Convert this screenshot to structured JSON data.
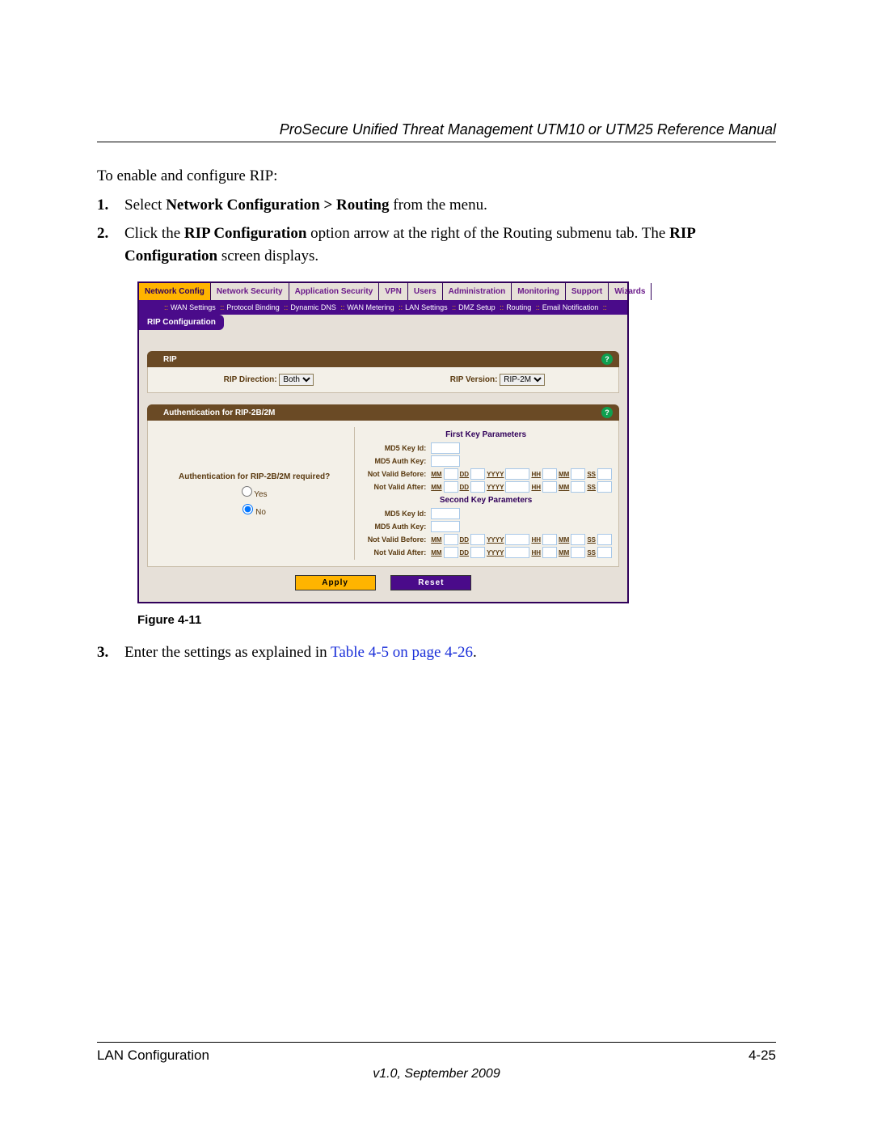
{
  "header": {
    "title": "ProSecure Unified Threat Management UTM10 or UTM25 Reference Manual"
  },
  "intro": "To enable and configure RIP:",
  "steps": {
    "s1": {
      "num": "1.",
      "prefix": "Select ",
      "bold": "Network Configuration > Routing",
      "suffix": " from the menu."
    },
    "s2": {
      "num": "2.",
      "p1a": "Click the ",
      "p1b": "RIP Configuration",
      "p1c": " option arrow at the right of the Routing submenu tab. The ",
      "p1d": "RIP Configuration",
      "p1e": " screen displays."
    },
    "s3": {
      "num": "3.",
      "t1": "Enter the settings as explained in ",
      "link": "Table 4-5 on page 4-26",
      "t2": "."
    }
  },
  "figure": {
    "caption": "Figure 4-11"
  },
  "ui": {
    "topnav": {
      "items": [
        "Network Config",
        "Network Security",
        "Application Security",
        "VPN",
        "Users",
        "Administration",
        "Monitoring",
        "Support",
        "Wizards"
      ],
      "active": "Network Config"
    },
    "subnav": [
      "WAN Settings",
      "Protocol Binding",
      "Dynamic DNS",
      "WAN Metering",
      "LAN Settings",
      "DMZ Setup",
      "Routing",
      "Email Notification"
    ],
    "subtab": "RIP Configuration",
    "rip": {
      "title": "RIP",
      "direction_label": "RIP Direction:",
      "direction_value": "Both",
      "version_label": "RIP Version:",
      "version_value": "RIP-2M"
    },
    "auth": {
      "title": "Authentication for RIP-2B/2M",
      "question": "Authentication for RIP-2B/2M required?",
      "yes": "Yes",
      "no": "No",
      "first_title": "First Key Parameters",
      "second_title": "Second Key Parameters",
      "md5_key_id": "MD5 Key Id:",
      "md5_auth_key": "MD5 Auth Key:",
      "not_valid_before": "Not Valid Before:",
      "not_valid_after": "Not Valid After:",
      "date_labels": {
        "mm": "MM",
        "dd": "DD",
        "yyyy": "YYYY",
        "hh": "HH",
        "ss": "SS"
      }
    },
    "buttons": {
      "apply": "Apply",
      "reset": "Reset"
    }
  },
  "footer": {
    "left": "LAN Configuration",
    "right": "4-25",
    "center": "v1.0, September 2009"
  }
}
